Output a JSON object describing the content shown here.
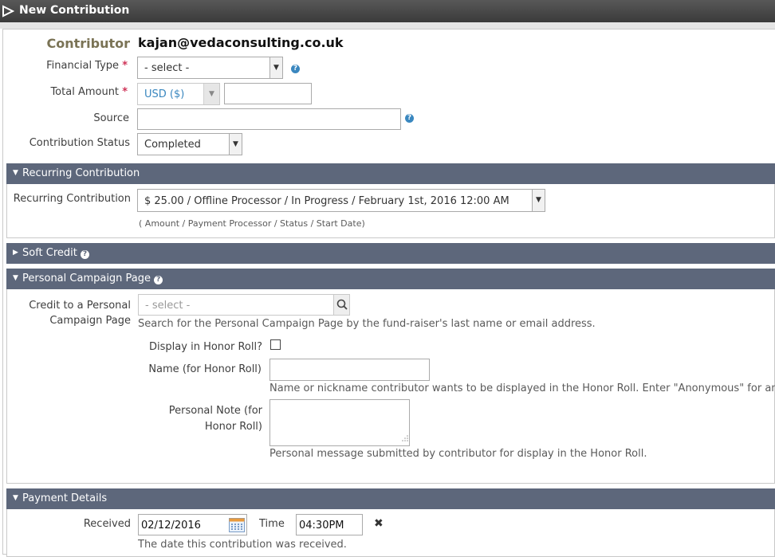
{
  "title": "New Contribution",
  "contributor": {
    "label": "Contributor",
    "value": "kajan@vedaconsulting.co.uk"
  },
  "fields": {
    "financial_type": {
      "label": "Financial Type",
      "required_mark": "*",
      "selected": "- select -"
    },
    "total_amount": {
      "label": "Total Amount",
      "required_mark": "*",
      "currency": "USD ($)",
      "value": ""
    },
    "source": {
      "label": "Source",
      "value": ""
    },
    "contribution_status": {
      "label": "Contribution Status",
      "selected": "Completed"
    }
  },
  "recurring": {
    "header": "Recurring Contribution",
    "label": "Recurring Contribution",
    "selected": "$ 25.00 / Offline Processor / In Progress / February 1st, 2016 12:00 AM",
    "hint": "( Amount / Payment Processor / Status / Start Date)"
  },
  "soft_credit": {
    "header": "Soft Credit"
  },
  "pcp": {
    "header": "Personal Campaign Page",
    "credit_label_line1": "Credit to a Personal",
    "credit_label_line2": "Campaign Page",
    "credit_placeholder": "- select -",
    "credit_hint": "Search for the Personal Campaign Page by the fund-raiser's last name or email address.",
    "honor_roll_label": "Display in Honor Roll?",
    "honor_roll_checked": false,
    "name_label": "Name (for Honor Roll)",
    "name_value": "",
    "name_hint": "Name or nickname contributor wants to be displayed in the Honor Roll. Enter \"Anonymous\" for anony",
    "note_label_line1": "Personal Note (for",
    "note_label_line2": "Honor Roll)",
    "note_value": "",
    "note_hint": "Personal message submitted by contributor for display in the Honor Roll."
  },
  "payment": {
    "header": "Payment Details",
    "received_label": "Received",
    "received_date": "02/12/2016",
    "time_label": "Time",
    "time_value": "04:30PM",
    "received_hint": "The date this contribution was received."
  },
  "colors": {
    "section_header": "#5d677b",
    "help_icon": "#3a87bf",
    "required": "#cf3458",
    "contributor_label": "#7a7355"
  },
  "icons": {
    "title_toggle": "triangle-right-outline-icon",
    "help": "question-circle-icon",
    "calendar": "calendar-icon",
    "search": "magnifier-icon",
    "clear": "x-icon"
  }
}
